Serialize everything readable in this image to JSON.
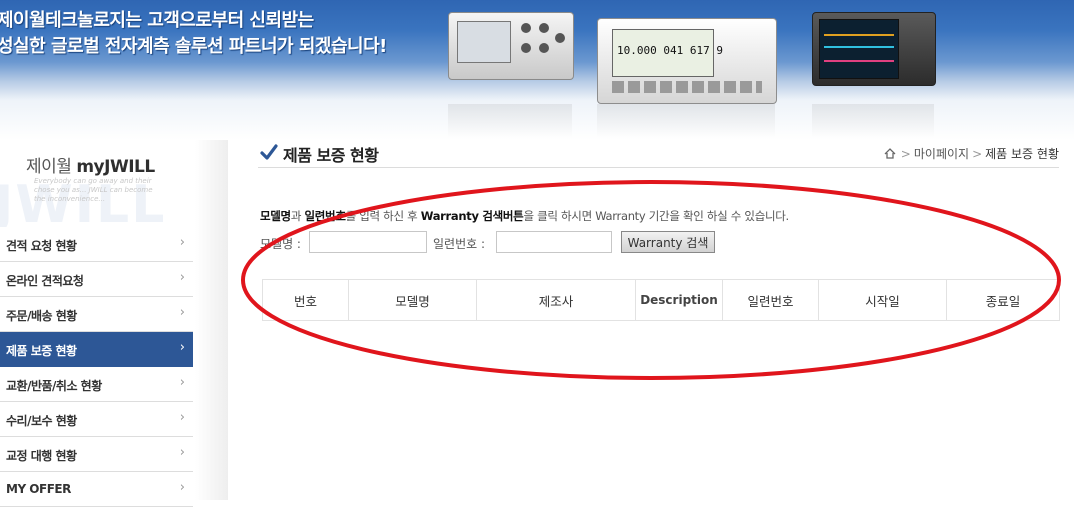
{
  "banner": {
    "line1": "제이월테크놀로지는 고객으로부터 신뢰받는",
    "line2": "성실한 글로벌 전자계측 솔루션 파트너가 되겠습니다!",
    "device_readout": "10.000 041 617 9"
  },
  "sidebar": {
    "title_prefix": "제이월",
    "title_brand": "myJWILL",
    "tagline": "Everybody can go away and their chose you as... JWILL can become the inconvenience...",
    "watermark": "JWILL",
    "items": [
      {
        "label": "견적 요청 현황"
      },
      {
        "label": "온라인 견적요청"
      },
      {
        "label": "주문/배송 현황"
      },
      {
        "label": "제품 보증 현황"
      },
      {
        "label": "교환/반품/취소 현황"
      },
      {
        "label": "수리/보수 현황"
      },
      {
        "label": "교정 대행 현황"
      },
      {
        "label": "MY OFFER"
      }
    ],
    "chevron": "›",
    "active_index": 3
  },
  "page": {
    "title": "제품 보증 현황",
    "breadcrumb": {
      "sep": ">",
      "mypage": "마이페이지",
      "current": "제품 보증 현황"
    }
  },
  "instructions": {
    "w1": "모델명",
    "t1": "과 ",
    "w2": "일련번호",
    "t2": "를 입력 하신 후 ",
    "w3": "Warranty 검색버튼",
    "t3": "을 클릭 하시면 Warranty 기간을 확인 하실 수 있습니다."
  },
  "search": {
    "model_label": "모델명 :",
    "model_value": "",
    "serial_label": "일련번호 :",
    "serial_value": "",
    "button_label": "Warranty 검색"
  },
  "table": {
    "headers": [
      "번호",
      "모델명",
      "제조사",
      "Description",
      "일련번호",
      "시작일",
      "종료일"
    ]
  },
  "colors": {
    "accent": "#2d5796",
    "annotation": "#e0151c"
  }
}
